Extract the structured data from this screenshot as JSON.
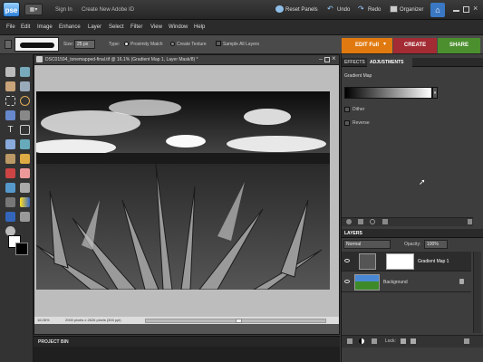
{
  "app": {
    "logo": "pse",
    "layout_label": "▦▾"
  },
  "topbar": {
    "sign_in": "Sign In",
    "create_id": "Create New Adobe ID",
    "reset_panels": "Reset Panels",
    "undo": "Undo",
    "redo": "Redo",
    "organizer": "Organizer"
  },
  "menu": [
    "File",
    "Edit",
    "Image",
    "Enhance",
    "Layer",
    "Select",
    "Filter",
    "View",
    "Window",
    "Help"
  ],
  "options": {
    "size_label": "Size:",
    "size_value": "25 px",
    "type_label": "Type:",
    "type_options": [
      "Proximity Match",
      "Create Texture"
    ],
    "sample_all_layers": "Sample All Layers"
  },
  "modes": {
    "edit": "EDIT Full",
    "create": "CREATE",
    "share": "SHARE"
  },
  "document": {
    "title": "DSC01594_tonemapped-final.tif @ 16.1% (Gradient Map 1, Layer Mask/8) *",
    "zoom": "16.06%",
    "dimensions": "2000 pixels x 2626 pixels (300 ppi)"
  },
  "project_bin": {
    "label": "PROJECT BIN"
  },
  "adjust_panel": {
    "tabs": [
      "EFFECTS",
      "ADJUSTMENTS"
    ],
    "title": "Gradient Map",
    "dither": "Dither",
    "reverse": "Reverse"
  },
  "layers_panel": {
    "title": "LAYERS",
    "blend_mode": "Normal",
    "opacity_label": "Opacity:",
    "opacity_value": "100%",
    "lock_label": "Lock:",
    "layers": [
      {
        "name": "Gradient Map 1"
      },
      {
        "name": "Background"
      }
    ]
  },
  "colors": {
    "edit_tab": "#e07a10",
    "create_tab": "#a32b33",
    "share_tab": "#4b8f2e",
    "accent": "#3a78c4"
  }
}
